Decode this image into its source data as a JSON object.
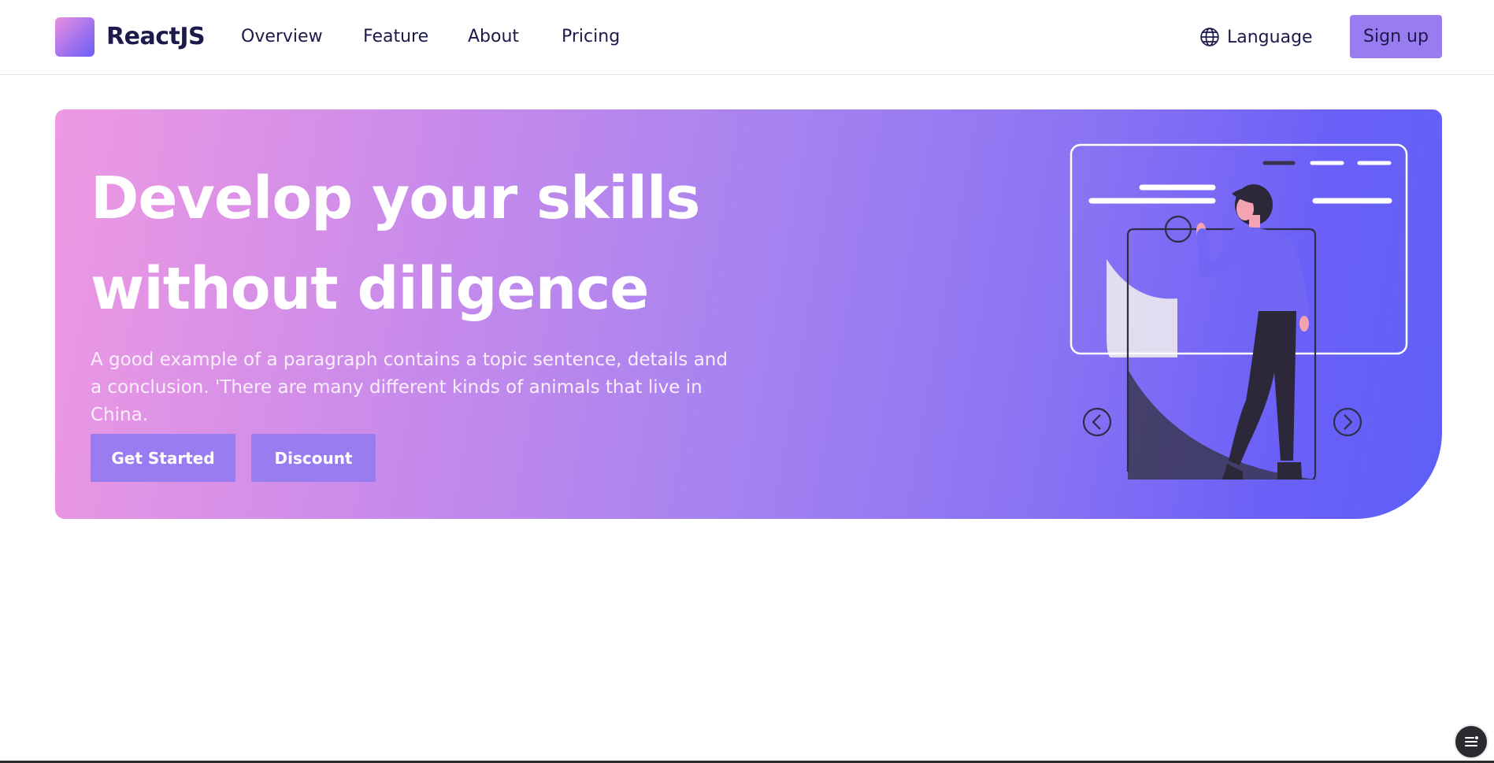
{
  "header": {
    "brand": "ReactJS",
    "nav": [
      {
        "label": "Overview"
      },
      {
        "label": "Feature"
      },
      {
        "label": "About"
      },
      {
        "label": "Pricing"
      }
    ],
    "language_label": "Language",
    "language_icon": "globe-icon",
    "signup_label": "Sign up"
  },
  "hero": {
    "title": "Develop your skills without diligence",
    "paragraph": "A good example of a paragraph contains a topic sentence, details and a conclusion. 'There are many different kinds of animals that live in China.",
    "primary_button": "Get Started",
    "secondary_button": "Discount",
    "illustration_icons": [
      "chevron-left-icon",
      "chevron-right-icon"
    ]
  },
  "colors": {
    "accent": "#9a7cf1",
    "text_dark": "#1b1a4b",
    "gradient_start": "#ee99e2",
    "gradient_end": "#5e5ff8"
  },
  "chat_widget_icon": "chat-menu-icon"
}
